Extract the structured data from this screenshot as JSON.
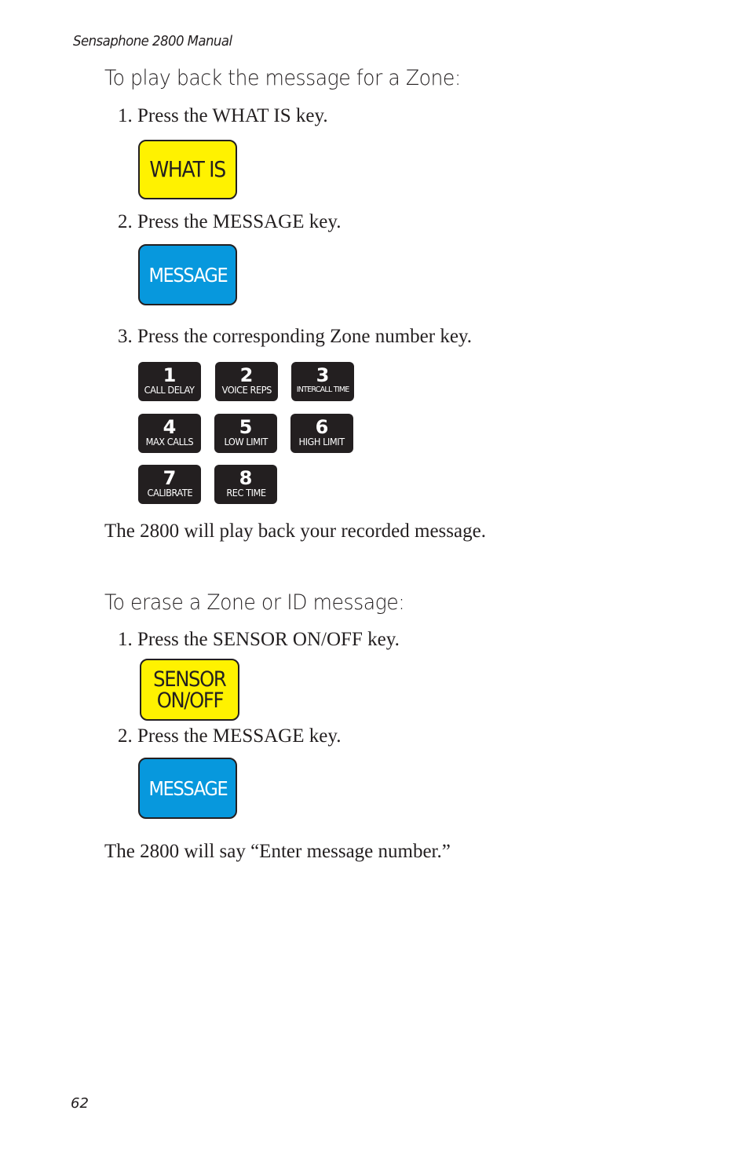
{
  "header": {
    "running_title": "Sensaphone 2800 Manual"
  },
  "section_playback": {
    "heading": "To play back the message for a Zone:",
    "steps": [
      {
        "text": "1. Press the WHAT IS key.",
        "key_label": "WHAT IS",
        "key_color": "#fff200"
      },
      {
        "text": "2. Press the MESSAGE key.",
        "key_label": "MESSAGE",
        "key_color": "#0798dd"
      },
      {
        "text": "3. Press the corresponding Zone number key."
      }
    ],
    "zone_keys": [
      {
        "number": "1",
        "label": "CALL DELAY"
      },
      {
        "number": "2",
        "label": "VOICE REPS"
      },
      {
        "number": "3",
        "label": "INTERCALL TIME"
      },
      {
        "number": "4",
        "label": "MAX CALLS"
      },
      {
        "number": "5",
        "label": "LOW LIMIT"
      },
      {
        "number": "6",
        "label": "HIGH LIMIT"
      },
      {
        "number": "7",
        "label": "CALIBRATE"
      },
      {
        "number": "8",
        "label": "REC TIME"
      }
    ],
    "result": "The 2800 will play back your recorded message."
  },
  "section_erase": {
    "heading": "To erase a Zone or ID message:",
    "steps": [
      {
        "text": "1. Press the SENSOR ON/OFF key.",
        "key_label_line1": "SENSOR",
        "key_label_line2": "ON/OFF",
        "key_color": "#fff200"
      },
      {
        "text": "2. Press the MESSAGE key.",
        "key_label": "MESSAGE",
        "key_color": "#0798dd"
      }
    ],
    "result": "The 2800 will say “Enter message number.”"
  },
  "footer": {
    "page_number": "62"
  }
}
